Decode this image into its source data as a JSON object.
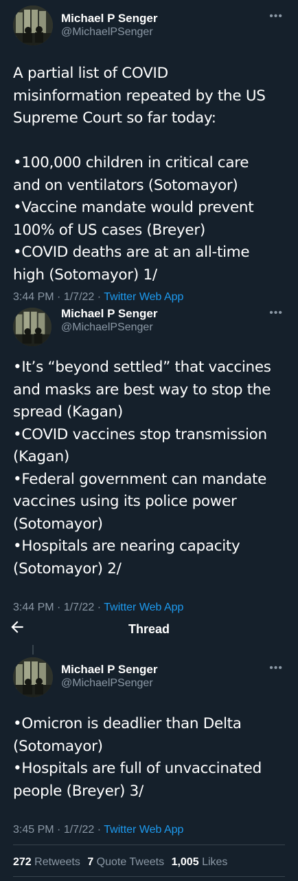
{
  "colors": {
    "background": "#15202b",
    "text_primary": "#ffffff",
    "text_secondary": "#8b98a5",
    "link": "#1d9bf0",
    "divider": "#38444d"
  },
  "author": {
    "name": "Michael P Senger",
    "handle": "@MichaelPSenger"
  },
  "more_icon": "more-horizontal-icon",
  "tweets": [
    {
      "text": "A partial list of COVID\nmisinformation repeated by the US\nSupreme Court so far today:\n\n•100,000 children in critical care\nand on ventilators (Sotomayor)\n•Vaccine mandate would prevent\n100% of US cases (Breyer)\n•COVID deaths are at an all-time\nhigh (Sotomayor) 1/",
      "time": "3:44 PM",
      "date": "1/7/22",
      "source": "Twitter Web App"
    },
    {
      "text": "•It’s “beyond settled” that vaccines\nand masks are best way to stop the\nspread (Kagan)\n•COVID vaccines stop transmission\n(Kagan)\n•Federal government can mandate\nvaccines using its police power\n(Sotomayor)\n•Hospitals are nearing capacity\n(Sotomayor) 2/",
      "time": "3:44 PM",
      "date": "1/7/22",
      "source": "Twitter Web App"
    },
    {
      "text": "•Omicron is deadlier than Delta\n(Sotomayor)\n•Hospitals are full of unvaccinated\npeople (Breyer) 3/",
      "time": "3:45 PM",
      "date": "1/7/22",
      "source": "Twitter Web App"
    }
  ],
  "thread_header": {
    "title": "Thread",
    "back_icon": "back-arrow-icon"
  },
  "stats": {
    "retweets_count": "272",
    "retweets_label": "Retweets",
    "quotes_count": "7",
    "quotes_label": "Quote Tweets",
    "likes_count": "1,005",
    "likes_label": "Likes"
  },
  "separator": "·"
}
